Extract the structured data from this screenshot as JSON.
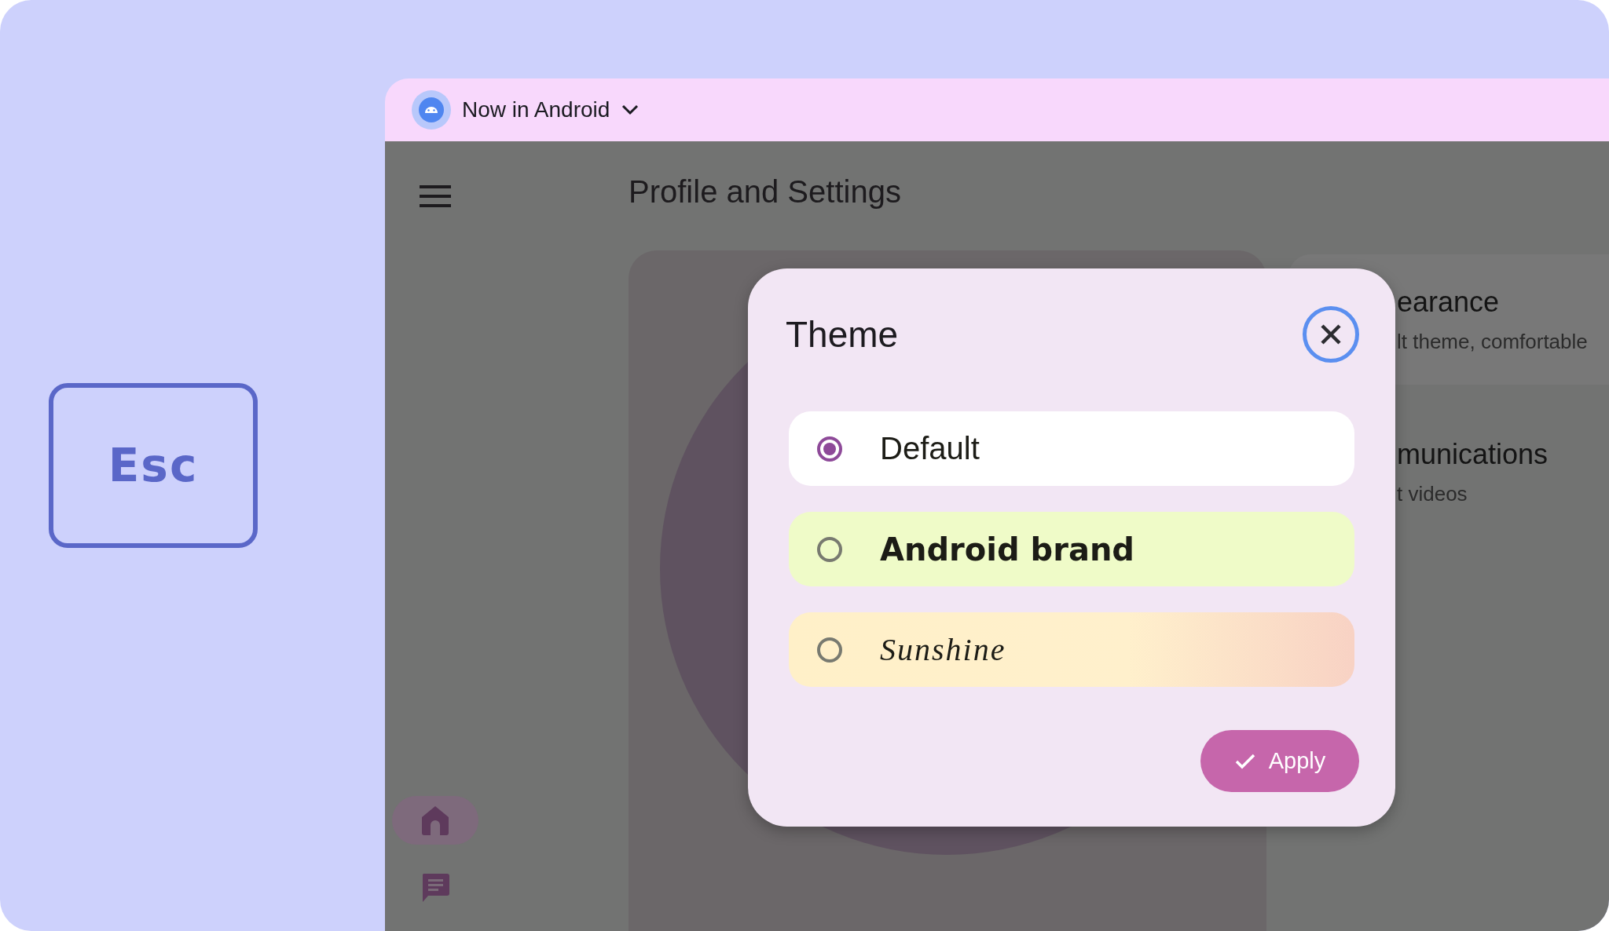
{
  "key_hint": {
    "label": "Esc"
  },
  "app_bar": {
    "title": "Now in Android"
  },
  "screen": {
    "title": "Profile and Settings",
    "nav_items": [
      {
        "kind": "home",
        "selected": true
      },
      {
        "kind": "chat",
        "selected": false
      }
    ],
    "settings_cards": [
      {
        "title": "earance",
        "subtitle": "lt theme, comfortable"
      },
      {
        "title": "munications",
        "subtitle": "t videos"
      }
    ]
  },
  "dialog": {
    "title": "Theme",
    "options": [
      {
        "label": "Default",
        "kind": "default",
        "selected": true
      },
      {
        "label": "Android brand",
        "kind": "brand",
        "selected": false
      },
      {
        "label": "Sunshine",
        "kind": "sunshine",
        "selected": false
      }
    ],
    "apply_button": "Apply"
  }
}
